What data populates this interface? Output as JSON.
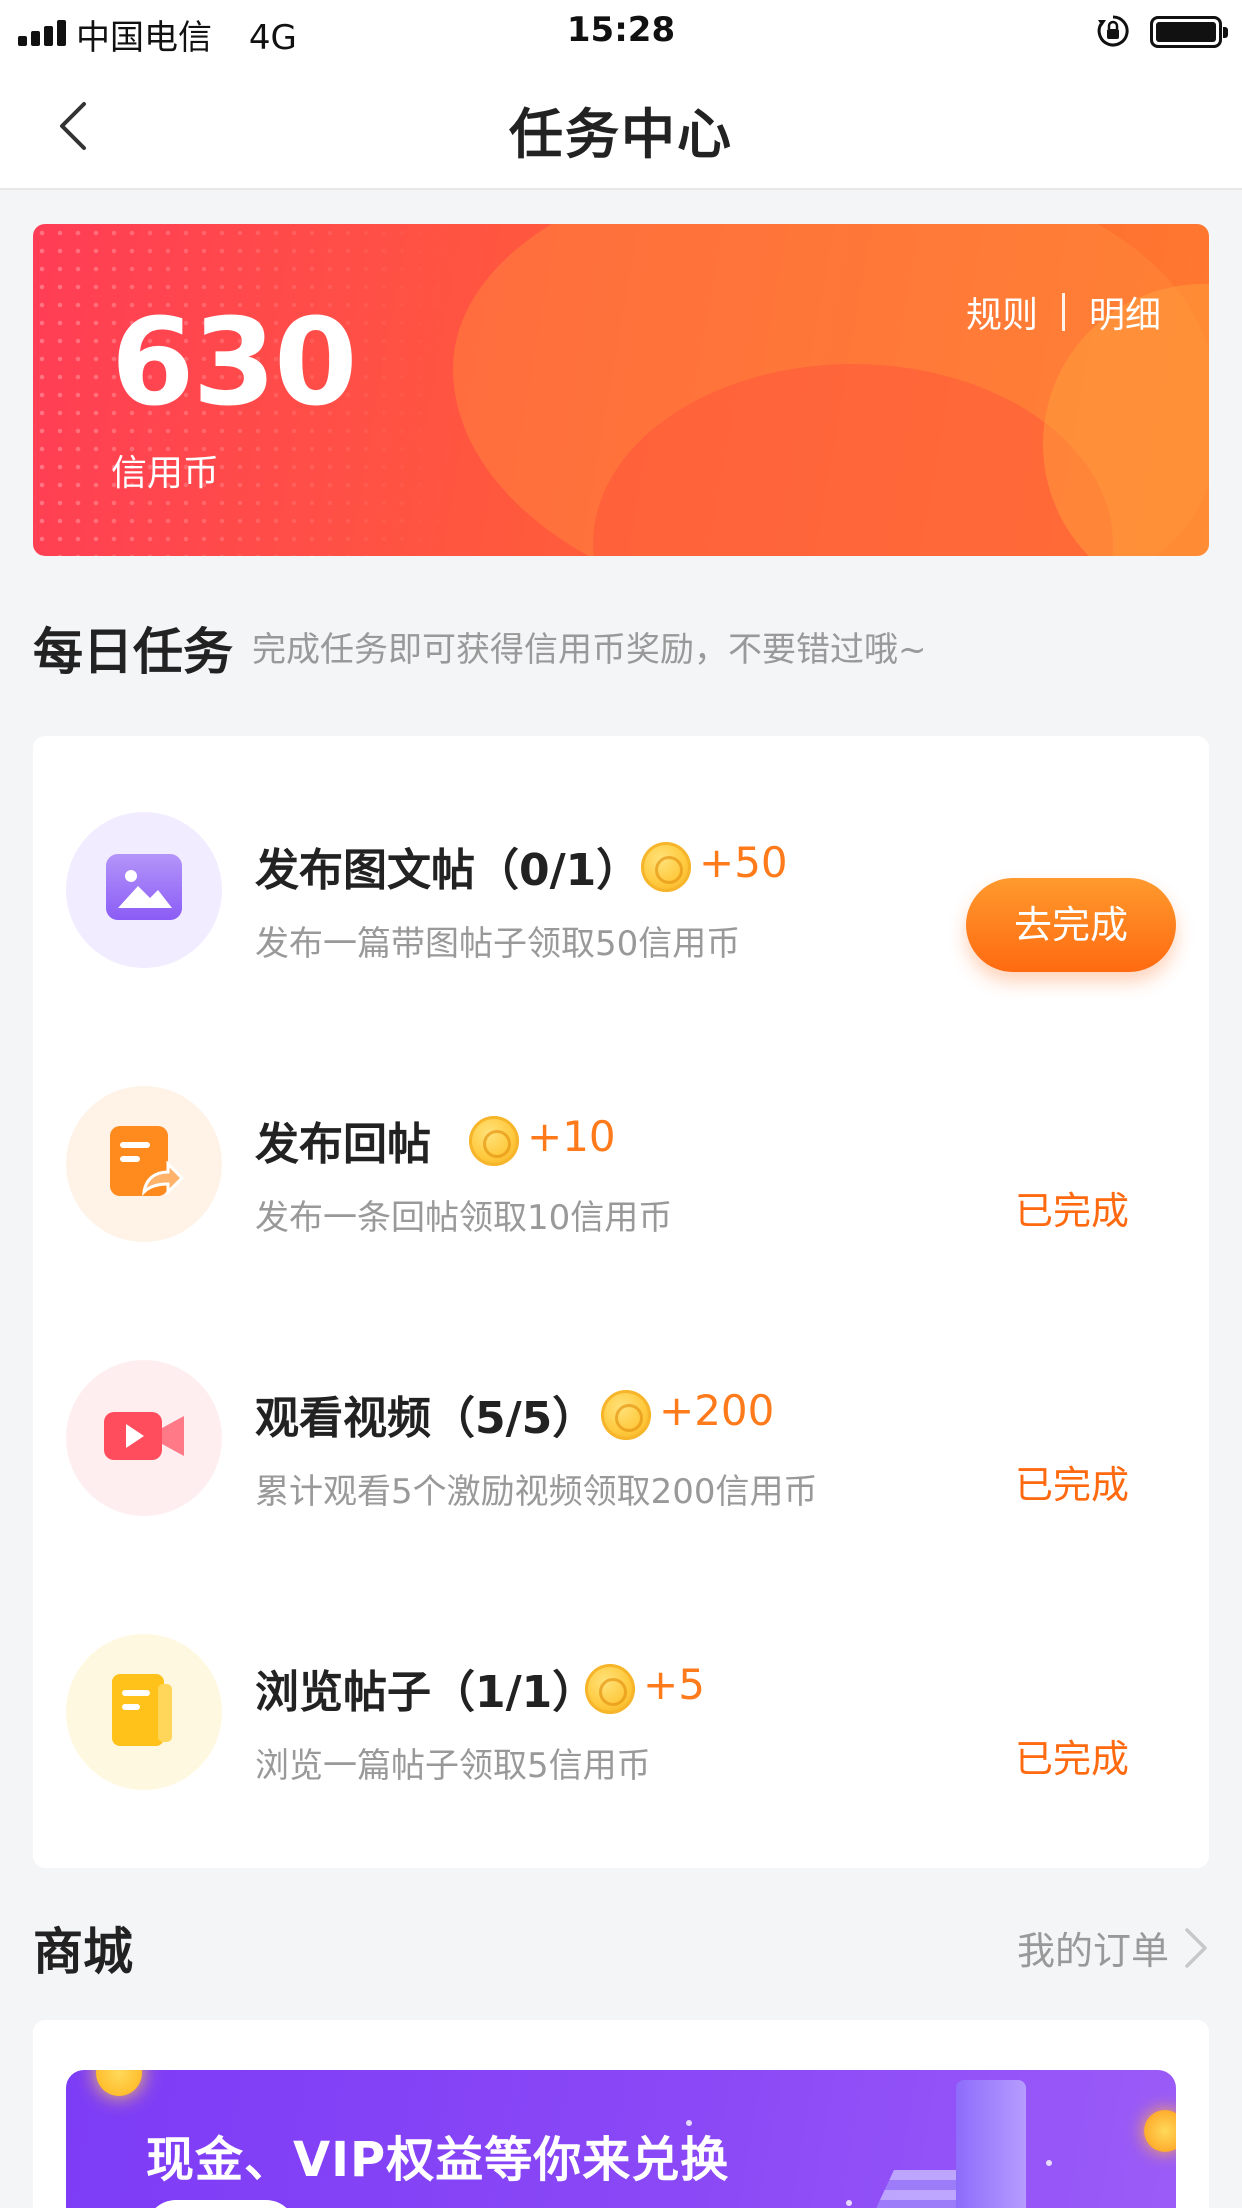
{
  "status_bar": {
    "carrier": "中国电信",
    "network": "4G",
    "time": "15:28",
    "icons": [
      "signal-icon",
      "orientation-lock-icon",
      "battery-icon"
    ]
  },
  "nav": {
    "title": "任务中心",
    "back_icon": "back-arrow-icon"
  },
  "balance": {
    "value": "630",
    "unit": "信用币",
    "rules_label": "规则",
    "details_label": "明细",
    "colors": {
      "start": "#ff3d56",
      "end": "#ff7a2e"
    }
  },
  "daily": {
    "title": "每日任务",
    "subtitle": "完成任务即可获得信用币奖励，不要错过哦~"
  },
  "tasks": [
    {
      "name": "发布图文帖（0/1）",
      "reward": "+50",
      "desc": "发布一篇带图帖子领取50信用币",
      "action": "去完成",
      "done": false,
      "icon": "image-post-icon",
      "icon_bg": "#f1ecff",
      "icon_color": "#8b5cf6"
    },
    {
      "name": "发布回帖",
      "reward": "+10",
      "desc": "发布一条回帖领取10信用币",
      "action": "已完成",
      "done": true,
      "icon": "reply-post-icon",
      "icon_bg": "#fff2e6",
      "icon_color": "#ff8a1e"
    },
    {
      "name": "观看视频（5/5）",
      "reward": "+200",
      "desc": "累计观看5个激励视频领取200信用币",
      "action": "已完成",
      "done": true,
      "icon": "video-icon",
      "icon_bg": "#ffeef0",
      "icon_color": "#ff4d5e"
    },
    {
      "name": "浏览帖子（1/1）",
      "reward": "+5",
      "desc": "浏览一篇帖子领取5信用币",
      "action": "已完成",
      "done": true,
      "icon": "browse-post-icon",
      "icon_bg": "#fff8e0",
      "icon_color": "#ffc21a"
    }
  ],
  "mall": {
    "title": "商城",
    "orders_label": "我的订单",
    "banner_text": "现金、VIP权益等你来兑换"
  },
  "accent": "#ff6a10"
}
